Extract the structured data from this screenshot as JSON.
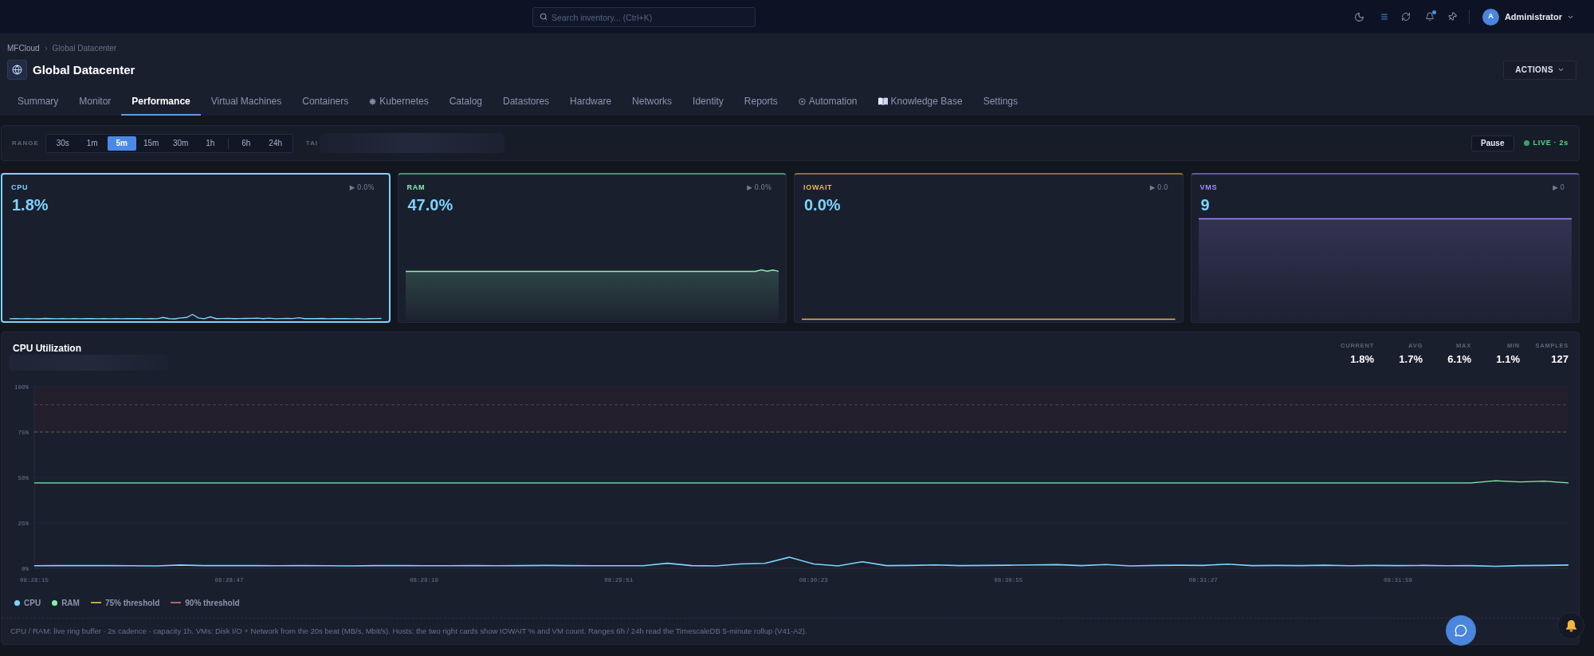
{
  "top_bar": {
    "search": {
      "placeholder": "Search inventory... (Ctrl+K)"
    },
    "notifications_unread": true,
    "user": {
      "initial": "A",
      "name": "Administrator"
    }
  },
  "header": {
    "breadcrumb": [
      {
        "label": "MFCloud",
        "current": false
      },
      {
        "label": "Global Datacenter",
        "current": true
      }
    ],
    "title": "Global Datacenter",
    "actions_button": "ACTIONS"
  },
  "tabs": [
    {
      "label": "Summary",
      "kind": "plain",
      "selected": false
    },
    {
      "label": "Monitor",
      "kind": "plain",
      "selected": false
    },
    {
      "label": "Performance",
      "kind": "plain",
      "selected": true
    },
    {
      "label": "Virtual Machines",
      "kind": "plain",
      "selected": false
    },
    {
      "label": "Containers",
      "kind": "plain",
      "selected": false
    },
    {
      "label": "Kubernetes",
      "kind": "wheel",
      "selected": false
    },
    {
      "label": "Catalog",
      "kind": "plain",
      "selected": false
    },
    {
      "label": "Datastores",
      "kind": "plain",
      "selected": false
    },
    {
      "label": "Hardware",
      "kind": "plain",
      "selected": false
    },
    {
      "label": "Networks",
      "kind": "plain",
      "selected": false
    },
    {
      "label": "Identity",
      "kind": "plain",
      "selected": false
    },
    {
      "label": "Reports",
      "kind": "plain",
      "selected": false
    },
    {
      "label": "Automation",
      "kind": "target",
      "selected": false
    },
    {
      "label": "Knowledge Base",
      "kind": "book",
      "selected": false
    },
    {
      "label": "Settings",
      "kind": "plain",
      "selected": false
    }
  ],
  "range_bar": {
    "label": "RANGE",
    "groups": [
      {
        "options": [
          {
            "label": "30s",
            "selected": false
          },
          {
            "label": "1m",
            "selected": false
          },
          {
            "label": "5m",
            "selected": true
          },
          {
            "label": "15m",
            "selected": false
          },
          {
            "label": "30m",
            "selected": false
          },
          {
            "label": "1h",
            "selected": false
          }
        ]
      },
      {
        "options": [
          {
            "label": "6h",
            "selected": false
          },
          {
            "label": "24h",
            "selected": false
          }
        ]
      }
    ],
    "control_2": {
      "label": "TAI"
    },
    "pause_button": "Pause",
    "live": {
      "label": "LIVE · 2s",
      "on": true
    }
  },
  "cards": [
    {
      "label": "CPU",
      "value": "1.8%",
      "delta": "▶ 0.0%",
      "color": "#7dd3fc",
      "selected": true
    },
    {
      "label": "RAM",
      "value": "47.0%",
      "delta": "▶ 0.0%",
      "color": "#86efac",
      "selected": false
    },
    {
      "label": "IOWAIT",
      "value": "0.0%",
      "delta": "▶ 0.0",
      "color": "#e8b84a",
      "selected": false
    },
    {
      "label": "VMS",
      "value": "9",
      "delta": "▶ 0",
      "color": "#a78bfa",
      "selected": false
    }
  ],
  "chart_panel": {
    "title": "CPU Utilization",
    "stats": [
      {
        "label": "CURRENT",
        "value": "1.8%"
      },
      {
        "label": "AVG",
        "value": "1.7%"
      },
      {
        "label": "MAX",
        "value": "6.1%"
      },
      {
        "label": "MIN",
        "value": "1.1%"
      },
      {
        "label": "SAMPLES",
        "value": "127"
      }
    ],
    "chart_data": {
      "type": "line",
      "categories": [
        "08:28:15",
        null,
        null,
        null,
        null,
        null,
        null,
        null,
        "08:28:47",
        null,
        null,
        null,
        null,
        null,
        null,
        null,
        "08:29:19",
        null,
        null,
        null,
        null,
        null,
        null,
        null,
        "08:29:51",
        null,
        null,
        null,
        null,
        null,
        null,
        null,
        "08:30:23",
        null,
        null,
        null,
        null,
        null,
        null,
        null,
        "08:30:55",
        null,
        null,
        null,
        null,
        null,
        null,
        null,
        "08:31:27",
        null,
        null,
        null,
        null,
        null,
        null,
        null,
        "08:31:59",
        null,
        null,
        null,
        null,
        null,
        null,
        null
      ],
      "ylim": [
        0,
        100
      ],
      "yticks": [
        {
          "value": 0,
          "label": "0%"
        },
        {
          "value": 25,
          "label": "25%"
        },
        {
          "value": 50,
          "label": "50%"
        },
        {
          "value": 75,
          "label": "75%"
        },
        {
          "value": 100,
          "label": "100%"
        }
      ],
      "series": [
        {
          "name": "CPU",
          "color": "#7dd3fc",
          "values": [
            1.4,
            1.5,
            1.5,
            1.5,
            1.4,
            1.3,
            1.8,
            1.5,
            1.5,
            1.5,
            1.4,
            1.5,
            1.4,
            1.3,
            1.5,
            1.5,
            1.4,
            1.4,
            1.5,
            1.4,
            1.5,
            1.6,
            1.5,
            1.4,
            1.4,
            1.4,
            2.8,
            1.5,
            1.3,
            2.4,
            2.7,
            6.1,
            2.4,
            1.3,
            3.6,
            1.5,
            1.6,
            1.9,
            1.5,
            1.6,
            1.7,
            1.9,
            2.0,
            1.5,
            2.1,
            1.3,
            1.6,
            1.7,
            1.6,
            2.3,
            1.5,
            1.6,
            1.5,
            1.7,
            1.4,
            1.6,
            1.5,
            1.6,
            1.4,
            1.5,
            1.1,
            1.5,
            1.6,
            1.8
          ]
        },
        {
          "name": "RAM",
          "color": "#86efac",
          "values": [
            47,
            47,
            47,
            47,
            47,
            47,
            47,
            47,
            47,
            47,
            47,
            47,
            47,
            47,
            47,
            47,
            47,
            47,
            47,
            47,
            47,
            47,
            47,
            47,
            47,
            47,
            47,
            47,
            47,
            47,
            47,
            47,
            47,
            47,
            47,
            47,
            47,
            47,
            47,
            47,
            47,
            47,
            47,
            47,
            47,
            47,
            47,
            47,
            47,
            47,
            47,
            47,
            47,
            47,
            47,
            47,
            47,
            47,
            47,
            47,
            48.2,
            47.5,
            48.0,
            47
          ]
        }
      ],
      "bands": [
        {
          "axis": "y",
          "from": 75,
          "to": 100
        }
      ],
      "ref_lines": [
        {
          "axis": "y",
          "value": 75,
          "label": "75% threshold",
          "color": "#c9a33f"
        },
        {
          "axis": "y",
          "value": 90,
          "label": "90% threshold",
          "color": "#b4646e"
        }
      ]
    }
  },
  "footer_note": "CPU / RAM: live ring buffer · 2s cadence · capacity 1h. VMs: Disk I/O + Network from the 20s beat (MB/s, Mbit/s). Hosts: the two right cards show IOWAIT % and VM count. Ranges 6h / 24h read the TimescaleDB 5-minute rollup (V41-A2)."
}
